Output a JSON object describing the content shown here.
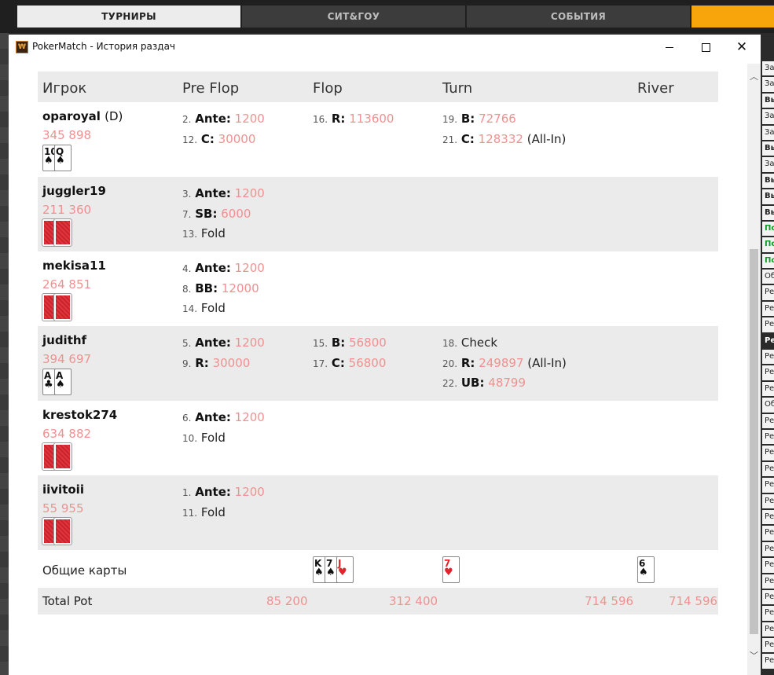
{
  "top_tabs": [
    "ТУРНИРЫ",
    "СИТ&ГОУ",
    "СОБЫТИЯ"
  ],
  "window": {
    "title": "PokerMatch - История раздач"
  },
  "right_list": [
    {
      "t": "За",
      "s": ""
    },
    {
      "t": "За",
      "s": ""
    },
    {
      "t": "Вы",
      "s": "b"
    },
    {
      "t": "За",
      "s": ""
    },
    {
      "t": "За",
      "s": ""
    },
    {
      "t": "Вы",
      "s": "b"
    },
    {
      "t": "За",
      "s": ""
    },
    {
      "t": "Вы",
      "s": "b"
    },
    {
      "t": "Вы",
      "s": "b"
    },
    {
      "t": "Вы",
      "s": "b"
    },
    {
      "t": "По",
      "s": "g"
    },
    {
      "t": "По",
      "s": "g"
    },
    {
      "t": "По",
      "s": "g"
    },
    {
      "t": "Об",
      "s": ""
    },
    {
      "t": "Ре",
      "s": ""
    },
    {
      "t": "Ре",
      "s": ""
    },
    {
      "t": "Ре",
      "s": ""
    },
    {
      "t": "Ре",
      "s": "sel"
    },
    {
      "t": "Ре",
      "s": ""
    },
    {
      "t": "Ре",
      "s": ""
    },
    {
      "t": "Ре",
      "s": ""
    },
    {
      "t": "Об",
      "s": ""
    },
    {
      "t": "Ре",
      "s": ""
    },
    {
      "t": "Ре",
      "s": ""
    },
    {
      "t": "Ре",
      "s": ""
    },
    {
      "t": "Ре",
      "s": ""
    },
    {
      "t": "Ре",
      "s": ""
    },
    {
      "t": "Ре",
      "s": ""
    },
    {
      "t": "Ре",
      "s": ""
    },
    {
      "t": "Ре",
      "s": ""
    },
    {
      "t": "Ре",
      "s": ""
    },
    {
      "t": "Ре",
      "s": ""
    },
    {
      "t": "Ре",
      "s": ""
    },
    {
      "t": "Ре",
      "s": ""
    },
    {
      "t": "Ре",
      "s": ""
    },
    {
      "t": "Ре",
      "s": ""
    },
    {
      "t": "Ре",
      "s": ""
    },
    {
      "t": "Ре",
      "s": ""
    }
  ],
  "headers": [
    "Игрок",
    "Pre Flop",
    "Flop",
    "Turn",
    "River"
  ],
  "players": [
    {
      "name": "oparoyal",
      "dealer": "(D)",
      "stack": "345 898",
      "cards": [
        {
          "r": "10",
          "s": "♠",
          "red": false
        },
        {
          "r": "Q",
          "s": "♠",
          "red": false
        }
      ],
      "preflop": [
        {
          "n": "2.",
          "k": "Ante:",
          "v": "1200",
          "x": ""
        },
        {
          "n": "12.",
          "k": "C:",
          "v": "30000",
          "x": ""
        }
      ],
      "flop": [
        {
          "n": "16.",
          "k": "R:",
          "v": "113600",
          "x": ""
        }
      ],
      "turn": [
        {
          "n": "19.",
          "k": "B:",
          "v": "72766",
          "x": ""
        },
        {
          "n": "21.",
          "k": "C:",
          "v": "128332",
          "x": "(All-In)"
        }
      ]
    },
    {
      "name": "juggler19",
      "dealer": "",
      "stack": "211 360",
      "cards": [
        {
          "back": true
        },
        {
          "back": true
        }
      ],
      "preflop": [
        {
          "n": "3.",
          "k": "Ante:",
          "v": "1200",
          "x": ""
        },
        {
          "n": "7.",
          "k": "SB:",
          "v": "6000",
          "x": ""
        },
        {
          "n": "13.",
          "k": "",
          "v": "",
          "x": "Fold"
        }
      ],
      "flop": [],
      "turn": []
    },
    {
      "name": "mekisa11",
      "dealer": "",
      "stack": "264 851",
      "cards": [
        {
          "back": true
        },
        {
          "back": true
        }
      ],
      "preflop": [
        {
          "n": "4.",
          "k": "Ante:",
          "v": "1200",
          "x": ""
        },
        {
          "n": "8.",
          "k": "BB:",
          "v": "12000",
          "x": ""
        },
        {
          "n": "14.",
          "k": "",
          "v": "",
          "x": "Fold"
        }
      ],
      "flop": [],
      "turn": []
    },
    {
      "name": "judithf",
      "dealer": "",
      "stack": "394 697",
      "cards": [
        {
          "r": "A",
          "s": "♣",
          "red": false
        },
        {
          "r": "A",
          "s": "♠",
          "red": false
        }
      ],
      "preflop": [
        {
          "n": "5.",
          "k": "Ante:",
          "v": "1200",
          "x": ""
        },
        {
          "n": "9.",
          "k": "R:",
          "v": "30000",
          "x": ""
        }
      ],
      "flop": [
        {
          "n": "15.",
          "k": "B:",
          "v": "56800",
          "x": ""
        },
        {
          "n": "17.",
          "k": "C:",
          "v": "56800",
          "x": ""
        }
      ],
      "turn": [
        {
          "n": "18.",
          "k": "",
          "v": "",
          "x": "Check"
        },
        {
          "n": "20.",
          "k": "R:",
          "v": "249897",
          "x": "(All-In)"
        },
        {
          "n": "22.",
          "k": "UB:",
          "v": "48799",
          "x": ""
        }
      ]
    },
    {
      "name": "krestok274",
      "dealer": "",
      "stack": "634 882",
      "cards": [
        {
          "back": true
        },
        {
          "back": true
        }
      ],
      "preflop": [
        {
          "n": "6.",
          "k": "Ante:",
          "v": "1200",
          "x": ""
        },
        {
          "n": "10.",
          "k": "",
          "v": "",
          "x": "Fold"
        }
      ],
      "flop": [],
      "turn": []
    },
    {
      "name": "iivitoii",
      "dealer": "",
      "stack": "55 955",
      "cards": [
        {
          "back": true
        },
        {
          "back": true
        }
      ],
      "preflop": [
        {
          "n": "1.",
          "k": "Ante:",
          "v": "1200",
          "x": ""
        },
        {
          "n": "11.",
          "k": "",
          "v": "",
          "x": "Fold"
        }
      ],
      "flop": [],
      "turn": []
    }
  ],
  "community": {
    "label": "Общие карты",
    "flop": [
      {
        "r": "K",
        "s": "♠",
        "red": false
      },
      {
        "r": "7",
        "s": "♠",
        "red": false
      },
      {
        "r": "J",
        "s": "♥",
        "red": true
      }
    ],
    "turn": [
      {
        "r": "7",
        "s": "♥",
        "red": true
      }
    ],
    "river": [
      {
        "r": "6",
        "s": "♠",
        "red": false
      }
    ]
  },
  "pot": {
    "label": "Total Pot",
    "preflop": "85 200",
    "flop": "312 400",
    "turn": "714 596",
    "river": "714 596"
  }
}
